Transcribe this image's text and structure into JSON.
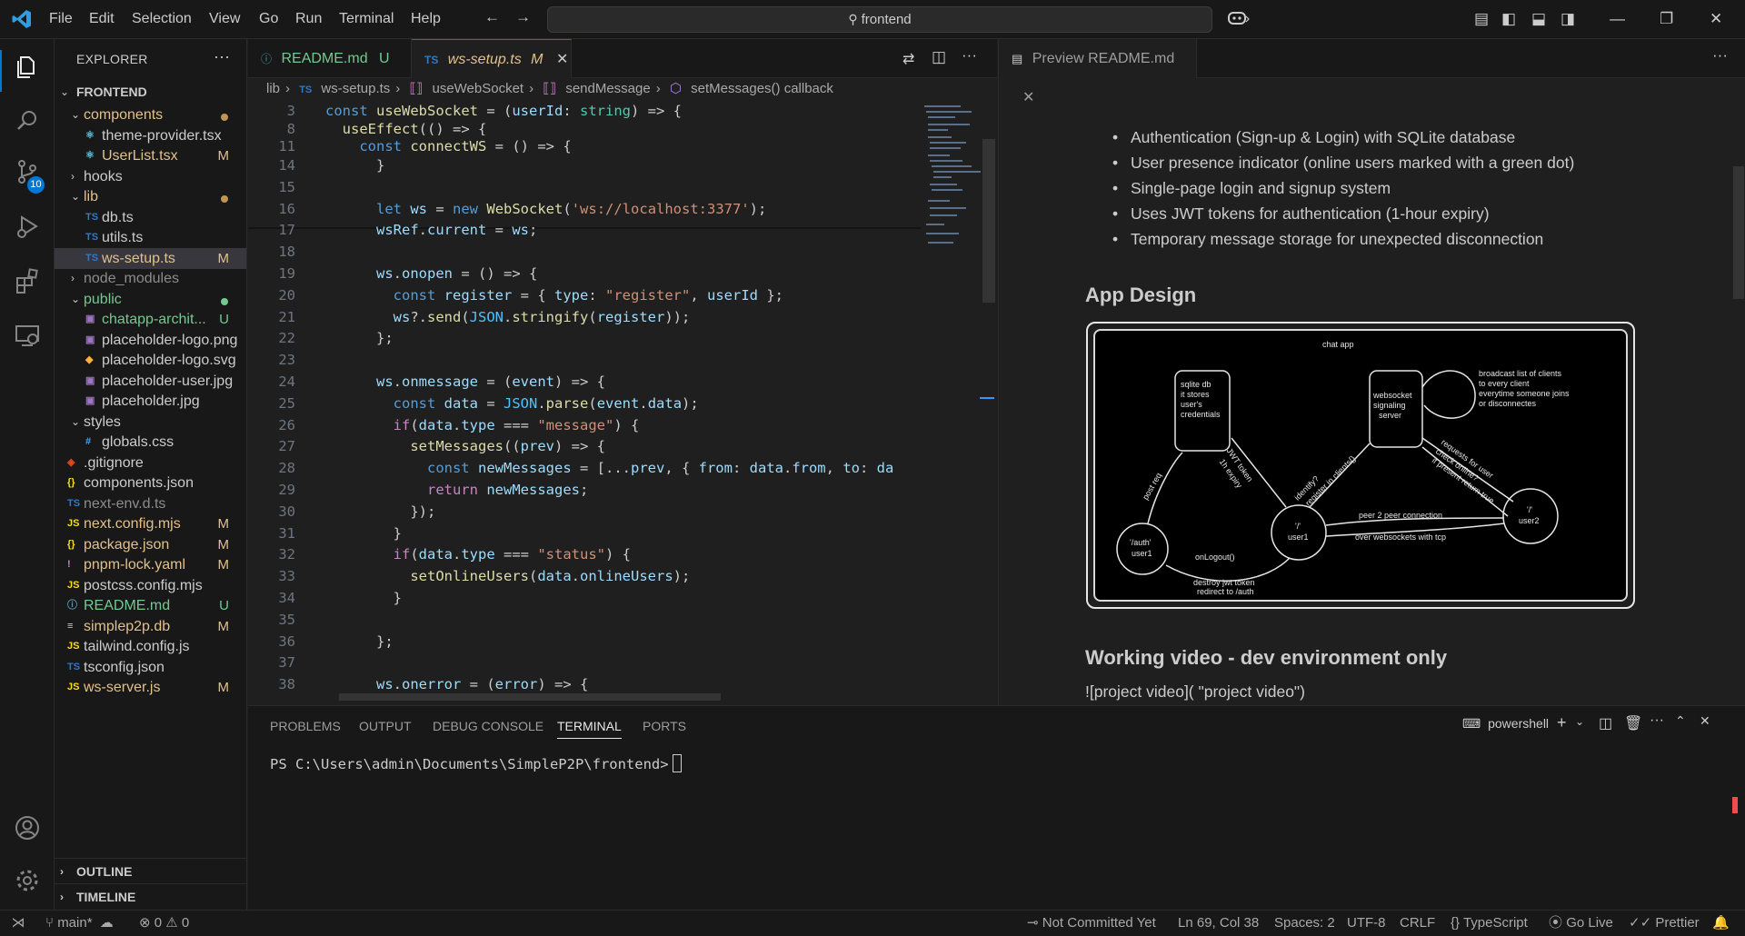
{
  "titlebar": {
    "menu": [
      "File",
      "Edit",
      "Selection",
      "View",
      "Go",
      "Run",
      "Terminal",
      "Help"
    ],
    "search_text": "frontend"
  },
  "activitybar": {
    "scm_badge": "10"
  },
  "explorer": {
    "title": "EXPLORER",
    "root": "FRONTEND",
    "items": [
      {
        "name": "components",
        "type": "folder",
        "status": "",
        "color": "#e2c08d"
      },
      {
        "name": "theme-provider.tsx",
        "type": "tsx",
        "status": "",
        "color": "#cccccc"
      },
      {
        "name": "UserList.tsx",
        "type": "tsx",
        "status": "M",
        "color": "#e2c08d"
      },
      {
        "name": "hooks",
        "type": "folder-closed",
        "status": "",
        "color": "#cccccc"
      },
      {
        "name": "lib",
        "type": "folder",
        "status": "",
        "color": "#e2c08d"
      },
      {
        "name": "db.ts",
        "type": "ts",
        "status": "",
        "color": "#cccccc"
      },
      {
        "name": "utils.ts",
        "type": "ts",
        "status": "",
        "color": "#cccccc"
      },
      {
        "name": "ws-setup.ts",
        "type": "ts",
        "status": "M",
        "color": "#e2c08d"
      },
      {
        "name": "node_modules",
        "type": "folder-closed",
        "status": "",
        "color": "#8c8c8c"
      },
      {
        "name": "public",
        "type": "folder",
        "status": "",
        "color": "#73c991"
      },
      {
        "name": "chatapp-archit...",
        "type": "img",
        "status": "U",
        "color": "#73c991"
      },
      {
        "name": "placeholder-logo.png",
        "type": "img",
        "status": "",
        "color": "#cccccc"
      },
      {
        "name": "placeholder-logo.svg",
        "type": "svg",
        "status": "",
        "color": "#cccccc"
      },
      {
        "name": "placeholder-user.jpg",
        "type": "img",
        "status": "",
        "color": "#cccccc"
      },
      {
        "name": "placeholder.jpg",
        "type": "img",
        "status": "",
        "color": "#cccccc"
      },
      {
        "name": "styles",
        "type": "folder",
        "status": "",
        "color": "#cccccc"
      },
      {
        "name": "globals.css",
        "type": "css",
        "status": "",
        "color": "#cccccc"
      },
      {
        "name": ".gitignore",
        "type": "git",
        "status": "",
        "color": "#cccccc"
      },
      {
        "name": "components.json",
        "type": "json",
        "status": "",
        "color": "#cccccc"
      },
      {
        "name": "next-env.d.ts",
        "type": "ts",
        "status": "",
        "color": "#8c8c8c"
      },
      {
        "name": "next.config.mjs",
        "type": "js",
        "status": "M",
        "color": "#e2c08d"
      },
      {
        "name": "package.json",
        "type": "json",
        "status": "M",
        "color": "#e2c08d"
      },
      {
        "name": "pnpm-lock.yaml",
        "type": "yaml",
        "status": "M",
        "color": "#e2c08d"
      },
      {
        "name": "postcss.config.mjs",
        "type": "js",
        "status": "",
        "color": "#cccccc"
      },
      {
        "name": "README.md",
        "type": "md",
        "status": "U",
        "color": "#73c991"
      },
      {
        "name": "simplep2p.db",
        "type": "db",
        "status": "M",
        "color": "#e2c08d"
      },
      {
        "name": "tailwind.config.js",
        "type": "js",
        "status": "",
        "color": "#cccccc"
      },
      {
        "name": "tsconfig.json",
        "type": "tsconfig",
        "status": "",
        "color": "#cccccc"
      },
      {
        "name": "ws-server.js",
        "type": "js",
        "status": "M",
        "color": "#e2c08d"
      }
    ],
    "outline": "OUTLINE",
    "timeline": "TIMELINE"
  },
  "editor": {
    "tabs": [
      {
        "label": "README.md",
        "status": "U"
      },
      {
        "label": "ws-setup.ts",
        "status": "M"
      }
    ],
    "breadcrumbs": [
      "lib",
      "ws-setup.ts",
      "useWebSocket",
      "sendMessage",
      "setMessages() callback"
    ],
    "sticky": [
      {
        "ln": "3",
        "code": "const useWebSocket = (userId: string) => {"
      },
      {
        "ln": "8",
        "code": "  useEffect(() => {"
      },
      {
        "ln": "11",
        "code": "    const connectWS = () => {"
      }
    ],
    "lines": [
      {
        "ln": "14",
        "code": "      }"
      },
      {
        "ln": "15",
        "code": ""
      },
      {
        "ln": "16",
        "code": "      let ws = new WebSocket('ws://localhost:3377');"
      },
      {
        "ln": "17",
        "code": "      wsRef.current = ws;"
      },
      {
        "ln": "18",
        "code": ""
      },
      {
        "ln": "19",
        "code": "      ws.onopen = () => {"
      },
      {
        "ln": "20",
        "code": "        const register = { type: \"register\", userId };"
      },
      {
        "ln": "21",
        "code": "        ws?.send(JSON.stringify(register));"
      },
      {
        "ln": "22",
        "code": "      };"
      },
      {
        "ln": "23",
        "code": ""
      },
      {
        "ln": "24",
        "code": "      ws.onmessage = (event) => {"
      },
      {
        "ln": "25",
        "code": "        const data = JSON.parse(event.data);"
      },
      {
        "ln": "26",
        "code": "        if(data.type === \"message\") {"
      },
      {
        "ln": "27",
        "code": "          setMessages((prev) => {"
      },
      {
        "ln": "28",
        "code": "            const newMessages = [...prev, { from: data.from, to: da"
      },
      {
        "ln": "29",
        "code": "            return newMessages;"
      },
      {
        "ln": "30",
        "code": "          });"
      },
      {
        "ln": "31",
        "code": "        }"
      },
      {
        "ln": "32",
        "code": "        if(data.type === \"status\") {"
      },
      {
        "ln": "33",
        "code": "          setOnlineUsers(data.onlineUsers);"
      },
      {
        "ln": "34",
        "code": "        }"
      },
      {
        "ln": "35",
        "code": ""
      },
      {
        "ln": "36",
        "code": "      };"
      },
      {
        "ln": "37",
        "code": ""
      },
      {
        "ln": "38",
        "code": "      ws.onerror = (error) => {"
      }
    ]
  },
  "preview": {
    "tab": "Preview README.md",
    "bullets": [
      "Authentication (Sign-up & Login) with SQLite database",
      "User presence indicator (online users marked with a green dot)",
      "Single-page login and signup system",
      "Uses JWT tokens for authentication (1-hour expiry)",
      "Temporary message storage for unexpected disconnection"
    ],
    "heading1": "App Design",
    "heading2": "Working video - dev environment only",
    "video_text": "![project video]( \"project video\")",
    "diagram": {
      "title": "chat app",
      "db_label": [
        "sqlite db",
        "it stores",
        "user's",
        "credentials"
      ],
      "server_label": [
        "websocket",
        "signaling",
        "server"
      ],
      "broadcast_label": [
        "broadcast list of clients",
        "to every client",
        "everytime someone joins",
        "or disconnectes"
      ],
      "auth_label": [
        "'/auth'",
        "user1"
      ],
      "user1_label": [
        "'/'",
        "user1"
      ],
      "user2_label": [
        "'/'",
        "user2"
      ],
      "post_req": "post req",
      "jwt_token": "JWT token",
      "expiry": "1h expiry",
      "identify": "identify?",
      "register_clients": "register in clients{}",
      "request_user": "requests for user",
      "check_online": "check online?",
      "present_return": "if present return true",
      "peer2peer": "peer 2 peer connection",
      "over_ws": "over websockets with tcp",
      "onlogout": "onLogout()",
      "destroy": [
        "destroy jwt token",
        "redirect to /auth"
      ]
    }
  },
  "panel": {
    "tabs": [
      "PROBLEMS",
      "OUTPUT",
      "DEBUG CONSOLE",
      "TERMINAL",
      "PORTS"
    ],
    "active_tab": "TERMINAL",
    "shell": "powershell",
    "prompt": "PS C:\\Users\\admin\\Documents\\SimpleP2P\\frontend>"
  },
  "statusbar": {
    "branch": "main*",
    "errors": "0",
    "warnings": "0",
    "commit": "Not Committed Yet",
    "position": "Ln 69, Col 38",
    "spaces": "Spaces: 2",
    "encoding": "UTF-8",
    "eol": "CRLF",
    "language": "TypeScript",
    "golive": "Go Live",
    "prettier": "Prettier"
  }
}
